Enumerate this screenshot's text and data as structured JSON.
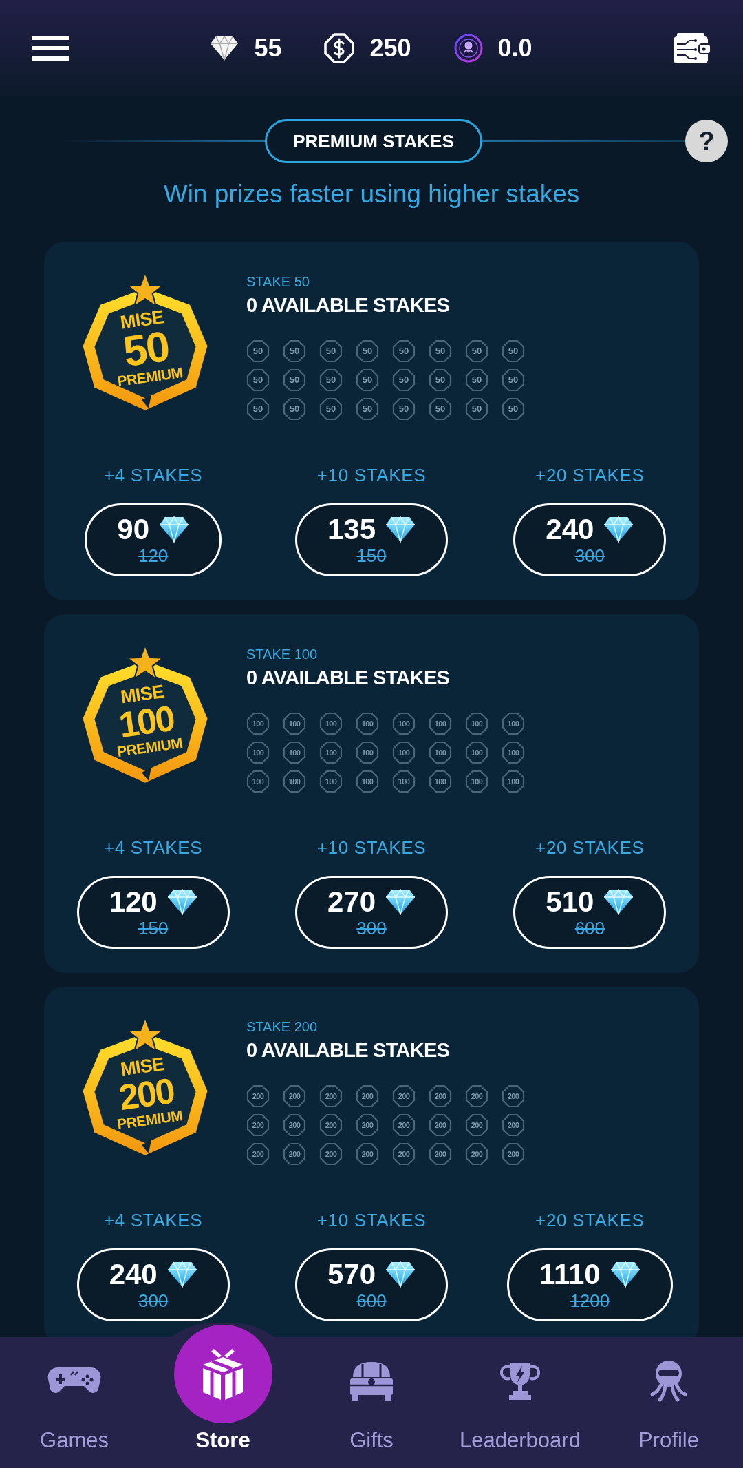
{
  "top_bar": {
    "balances": [
      {
        "kind": "gems",
        "value": "55"
      },
      {
        "kind": "coins",
        "value": "250"
      },
      {
        "kind": "tokens",
        "value": "0.0"
      }
    ]
  },
  "header": {
    "title": "PREMIUM STAKES",
    "help": "?",
    "subtitle": "Win prizes faster using higher stakes"
  },
  "cards": [
    {
      "badge": {
        "top": "MISE",
        "value": "50",
        "bottom": "PREMIUM"
      },
      "label": "STAKE 50",
      "title": "0 AVAILABLE STAKES",
      "tokens": [
        {
          "label": "50",
          "available": false
        },
        {
          "label": "50",
          "available": false
        },
        {
          "label": "50",
          "available": false
        },
        {
          "label": "50",
          "available": false
        },
        {
          "label": "50",
          "available": false
        },
        {
          "label": "50",
          "available": false
        },
        {
          "label": "50",
          "available": false
        },
        {
          "label": "50",
          "available": false
        },
        {
          "label": "50",
          "available": false
        },
        {
          "label": "50",
          "available": false
        },
        {
          "label": "50",
          "available": false
        },
        {
          "label": "50",
          "available": false
        },
        {
          "label": "50",
          "available": false
        },
        {
          "label": "50",
          "available": false
        },
        {
          "label": "50",
          "available": false
        },
        {
          "label": "50",
          "available": false
        },
        {
          "label": "50",
          "available": false
        },
        {
          "label": "50",
          "available": false
        },
        {
          "label": "50",
          "available": false
        },
        {
          "label": "50",
          "available": false
        },
        {
          "label": "50",
          "available": false
        },
        {
          "label": "50",
          "available": false
        },
        {
          "label": "50",
          "available": false
        },
        {
          "label": "50",
          "available": false
        }
      ],
      "offers": [
        {
          "label": "+4 STAKES",
          "price": "90",
          "old_price": "120"
        },
        {
          "label": "+10 STAKES",
          "price": "135",
          "old_price": "150"
        },
        {
          "label": "+20 STAKES",
          "price": "240",
          "old_price": "300"
        }
      ]
    },
    {
      "badge": {
        "top": "MISE",
        "value": "100",
        "bottom": "PREMIUM"
      },
      "label": "STAKE 100",
      "title": "0 AVAILABLE STAKES",
      "tokens": [
        {
          "label": "100",
          "available": false
        },
        {
          "label": "100",
          "available": false
        },
        {
          "label": "100",
          "available": false
        },
        {
          "label": "100",
          "available": false
        },
        {
          "label": "100",
          "available": false
        },
        {
          "label": "100",
          "available": false
        },
        {
          "label": "100",
          "available": false
        },
        {
          "label": "100",
          "available": false
        },
        {
          "label": "100",
          "available": false
        },
        {
          "label": "100",
          "available": false
        },
        {
          "label": "100",
          "available": false
        },
        {
          "label": "100",
          "available": false
        },
        {
          "label": "100",
          "available": false
        },
        {
          "label": "100",
          "available": false
        },
        {
          "label": "100",
          "available": false
        },
        {
          "label": "100",
          "available": false
        },
        {
          "label": "100",
          "available": false
        },
        {
          "label": "100",
          "available": false
        },
        {
          "label": "100",
          "available": false
        },
        {
          "label": "100",
          "available": false
        },
        {
          "label": "100",
          "available": false
        },
        {
          "label": "100",
          "available": false
        },
        {
          "label": "100",
          "available": false
        },
        {
          "label": "100",
          "available": false
        }
      ],
      "offers": [
        {
          "label": "+4 STAKES",
          "price": "120",
          "old_price": "150"
        },
        {
          "label": "+10 STAKES",
          "price": "270",
          "old_price": "300"
        },
        {
          "label": "+20 STAKES",
          "price": "510",
          "old_price": "600"
        }
      ]
    },
    {
      "badge": {
        "top": "MISE",
        "value": "200",
        "bottom": "PREMIUM"
      },
      "label": "STAKE 200",
      "title": "0 AVAILABLE STAKES",
      "tokens": [
        {
          "label": "200",
          "available": false
        },
        {
          "label": "200",
          "available": false
        },
        {
          "label": "200",
          "available": false
        },
        {
          "label": "200",
          "available": false
        },
        {
          "label": "200",
          "available": false
        },
        {
          "label": "200",
          "available": false
        },
        {
          "label": "200",
          "available": false
        },
        {
          "label": "200",
          "available": false
        },
        {
          "label": "200",
          "available": false
        },
        {
          "label": "200",
          "available": false
        },
        {
          "label": "200",
          "available": false
        },
        {
          "label": "200",
          "available": false
        },
        {
          "label": "200",
          "available": false
        },
        {
          "label": "200",
          "available": false
        },
        {
          "label": "200",
          "available": false
        },
        {
          "label": "200",
          "available": false
        },
        {
          "label": "200",
          "available": false
        },
        {
          "label": "200",
          "available": false
        },
        {
          "label": "200",
          "available": false
        },
        {
          "label": "200",
          "available": false
        },
        {
          "label": "200",
          "available": false
        },
        {
          "label": "200",
          "available": false
        },
        {
          "label": "200",
          "available": false
        },
        {
          "label": "200",
          "available": false
        }
      ],
      "offers": [
        {
          "label": "+4 STAKES",
          "price": "240",
          "old_price": "300"
        },
        {
          "label": "+10 STAKES",
          "price": "570",
          "old_price": "600"
        },
        {
          "label": "+20 STAKES",
          "price": "1110",
          "old_price": "1200"
        }
      ]
    }
  ],
  "bottom_nav": [
    {
      "kind": "games",
      "label": "Games",
      "selected": false
    },
    {
      "kind": "store",
      "label": "Store",
      "selected": true
    },
    {
      "kind": "gifts",
      "label": "Gifts",
      "selected": false
    },
    {
      "kind": "leaderboard",
      "label": "Leaderboard",
      "selected": false
    },
    {
      "kind": "profile",
      "label": "Profile",
      "selected": false
    }
  ]
}
